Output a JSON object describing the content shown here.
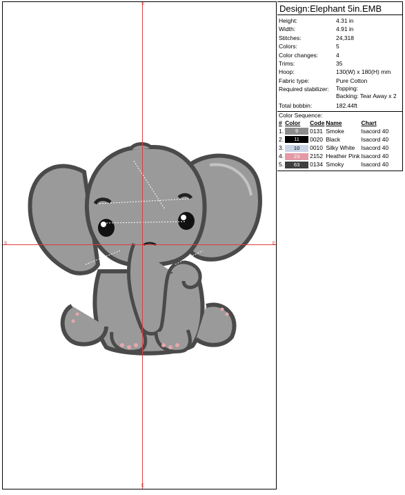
{
  "canvas": {
    "axis_labels": {
      "top": "S",
      "bottom": "E",
      "left": "S",
      "right": "E"
    },
    "colors": {
      "crosshair": "#e23b3b",
      "body_fill": "#9a9a9a",
      "outline": "#4a4a4a",
      "inner_ear": "#b8b8b8",
      "toes": "#e8a6ad"
    }
  },
  "info": {
    "title": "Design:Elephant 5in.EMB",
    "rows": [
      {
        "key": "Height:",
        "value": "4.31 in"
      },
      {
        "key": "Width:",
        "value": "4.91 in"
      },
      {
        "key": "Stitches:",
        "value": "24,318"
      },
      {
        "key": "Colors:",
        "value": "5"
      },
      {
        "key": "Color changes:",
        "value": "4"
      },
      {
        "key": "Trims:",
        "value": "35"
      },
      {
        "key": "Hoop:",
        "value": "130(W) x 180(H) mm"
      },
      {
        "key": "Fabric type:",
        "value": "Pure Cotton"
      },
      {
        "key": "Required stabilizer:",
        "value": "Topping:",
        "value2": "Backing: Tear Away x 2"
      },
      {
        "key": "Total bobbin:",
        "value": "182.44ft"
      }
    ],
    "sequence": {
      "title": "Color Sequence:",
      "headers": {
        "num": "#",
        "color": "Color",
        "code": "Code",
        "name": "Name",
        "chart": "Chart"
      },
      "items": [
        {
          "num": "1.",
          "swatch": "9",
          "color": "#8c8c8c",
          "code": "0131",
          "name": "Smoke",
          "chart": "Isacord 40"
        },
        {
          "num": "2.",
          "swatch": "11",
          "color": "#000000",
          "code": "0020",
          "name": "Black",
          "chart": "Isacord 40"
        },
        {
          "num": "3.",
          "swatch": "10",
          "color": "#c9d4e6",
          "code": "0010",
          "name": "Silky White",
          "chart": "Isacord 40"
        },
        {
          "num": "4.",
          "swatch": "23",
          "color": "#e39aa4",
          "code": "2152",
          "name": "Heather Pink",
          "chart": "Isacord 40"
        },
        {
          "num": "5.",
          "swatch": "63",
          "color": "#3f3f3f",
          "code": "0134",
          "name": "Smoky",
          "chart": "Isacord 40"
        }
      ]
    }
  }
}
